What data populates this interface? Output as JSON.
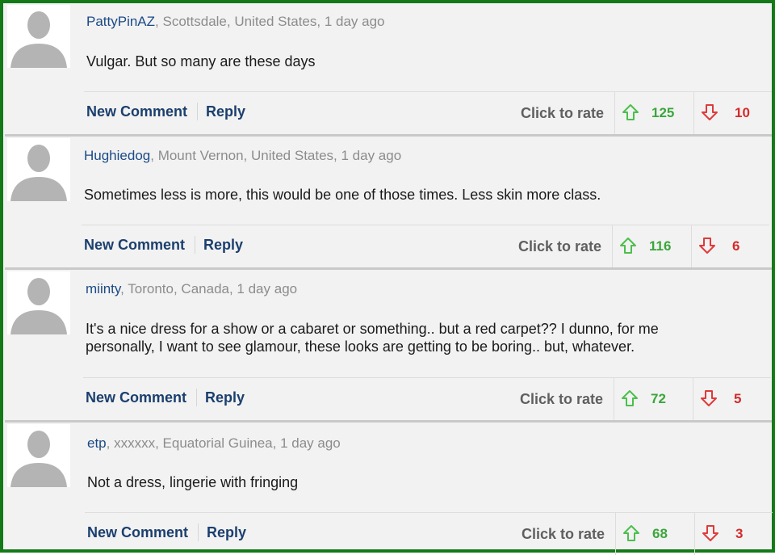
{
  "comments": [
    {
      "username": "PattyPinAZ",
      "location_time": ", Scottsdale, United States, 1 day ago",
      "text": "Vulgar. But so many are these days",
      "new_comment_label": "New Comment",
      "reply_label": "Reply",
      "rate_label": "Click to rate",
      "upvotes": "125",
      "downvotes": "10"
    },
    {
      "username": "Hughiedog",
      "location_time": ", Mount Vernon, United States, 1 day ago",
      "text": "Sometimes less is more, this would be one of those times. Less skin more class.",
      "new_comment_label": "New Comment",
      "reply_label": "Reply",
      "rate_label": "Click to rate",
      "upvotes": "116",
      "downvotes": "6"
    },
    {
      "username": "miinty",
      "location_time": ", Toronto, Canada, 1 day ago",
      "text": "It's a nice dress for a show or a cabaret or something.. but a red carpet?? I dunno, for me personally, I want to see glamour, these looks are getting to be boring.. but, whatever.",
      "new_comment_label": "New Comment",
      "reply_label": "Reply",
      "rate_label": "Click to rate",
      "upvotes": "72",
      "downvotes": "5"
    },
    {
      "username": "etp",
      "location_time": ", xxxxxx, Equatorial Guinea, 1 day ago",
      "text": "Not a dress, lingerie with fringing",
      "new_comment_label": "New Comment",
      "reply_label": "Reply",
      "rate_label": "Click to rate",
      "upvotes": "68",
      "downvotes": "3"
    }
  ],
  "icons": {
    "avatar": "default-avatar-silhouette",
    "upvote": "up-arrow-icon",
    "downvote": "down-arrow-icon"
  },
  "colors": {
    "frame_border": "#137a17",
    "username": "#1b4a86",
    "upvote": "#3ba63b",
    "downvote": "#d42a2a",
    "action_link": "#1b3f6e"
  }
}
